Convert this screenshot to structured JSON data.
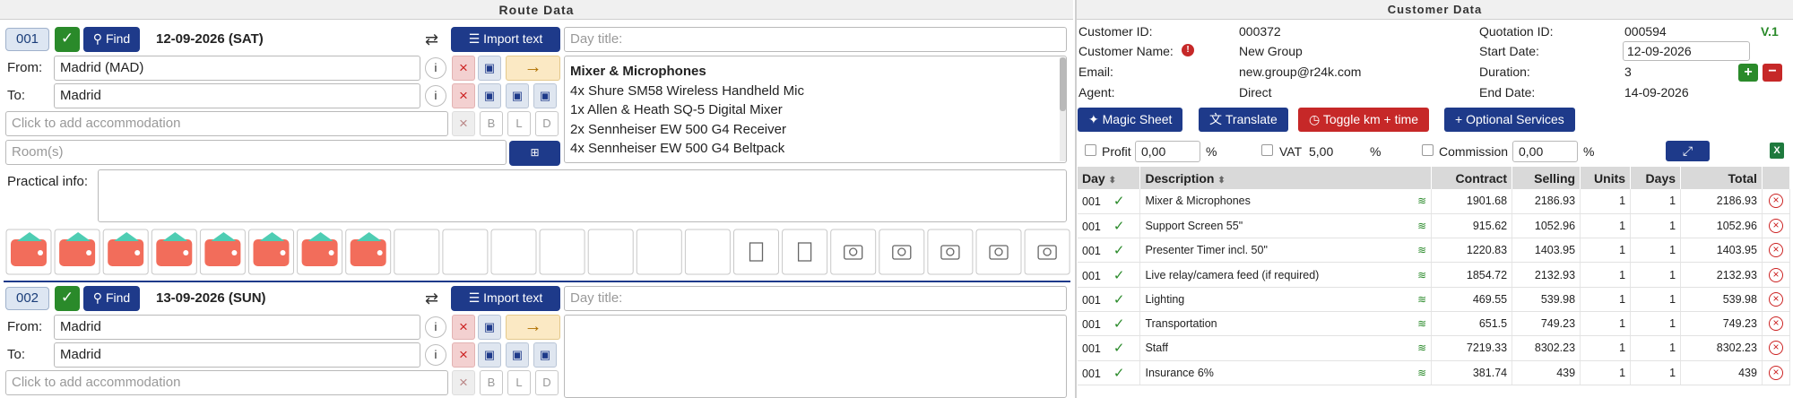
{
  "route": {
    "title": "Route Data"
  },
  "customer": {
    "title": "Customer Data",
    "version": "V.1",
    "fields": [
      {
        "label": "Customer ID:",
        "value": "000372"
      },
      {
        "label": "Customer Name:",
        "value": "New Group"
      },
      {
        "label": "Email:",
        "value": "new.group@r24k.com"
      },
      {
        "label": "Agent:",
        "value": "Direct"
      }
    ],
    "quotation_label": "Quotation ID:",
    "quotation_value": "000594",
    "start_label": "Start Date:",
    "start_value": "12-09-2026",
    "duration_label": "Duration:",
    "duration_value": "3",
    "end_label": "End Date:",
    "end_value": "14-09-2026",
    "buttons": {
      "magic": "Magic Sheet",
      "translate": "Translate",
      "toggle": "Toggle km + time",
      "optional": "Optional Services"
    },
    "profit_label": "Profit",
    "profit_value": "0,00",
    "pct": "%",
    "vat_label": "VAT",
    "vat_value": "5,00",
    "commission_label": "Commission",
    "commission_value": "0,00",
    "table": {
      "headers": [
        "Day",
        "Description",
        "Contract",
        "Selling",
        "Units",
        "Days",
        "Total"
      ],
      "rows": [
        {
          "day": "001",
          "desc": "Mixer & Microphones",
          "contract": "1901.68",
          "selling": "2186.93",
          "units": "1",
          "days": "1",
          "total": "2186.93"
        },
        {
          "day": "001",
          "desc": "Support Screen 55\"",
          "contract": "915.62",
          "selling": "1052.96",
          "units": "1",
          "days": "1",
          "total": "1052.96"
        },
        {
          "day": "001",
          "desc": "Presenter Timer incl. 50\"",
          "contract": "1220.83",
          "selling": "1403.95",
          "units": "1",
          "days": "1",
          "total": "1403.95"
        },
        {
          "day": "001",
          "desc": "Live relay/camera feed (if required)",
          "contract": "1854.72",
          "selling": "2132.93",
          "units": "1",
          "days": "1",
          "total": "2132.93"
        },
        {
          "day": "001",
          "desc": "Lighting",
          "contract": "469.55",
          "selling": "539.98",
          "units": "1",
          "days": "1",
          "total": "539.98"
        },
        {
          "day": "001",
          "desc": "Transportation",
          "contract": "651.5",
          "selling": "749.23",
          "units": "1",
          "days": "1",
          "total": "749.23"
        },
        {
          "day": "001",
          "desc": "Staff",
          "contract": "7219.33",
          "selling": "8302.23",
          "units": "1",
          "days": "1",
          "total": "8302.23"
        },
        {
          "day": "001",
          "desc": "Insurance 6%",
          "contract": "381.74",
          "selling": "439",
          "units": "1",
          "days": "1",
          "total": "439"
        }
      ]
    }
  },
  "days": [
    {
      "num": "001",
      "find": "Find",
      "date": "12-09-2026 (SAT)",
      "import": "Import text",
      "day_title_ph": "Day title:",
      "from_label": "From:",
      "from": "Madrid (MAD)",
      "to_label": "To:",
      "to": "Madrid",
      "accommodation_ph": "Click to add accommodation",
      "rooms_ph": "Room(s)",
      "practical_label": "Practical info:",
      "letters": [
        "B",
        "L",
        "D"
      ],
      "notes": [
        "Mixer & Microphones",
        "4x Shure SM58 Wireless Handheld Mic",
        "1x Allen & Heath SQ-5 Digital Mixer",
        "2x Sennheiser EW 500 G4 Receiver",
        "4x Sennheiser EW 500 G4 Beltpack"
      ]
    },
    {
      "num": "002",
      "find": "Find",
      "date": "13-09-2026 (SUN)",
      "import": "Import text",
      "day_title_ph": "Day title:",
      "from_label": "From:",
      "from": "Madrid",
      "to_label": "To:",
      "to": "Madrid",
      "accommodation_ph": "Click to add accommodation",
      "letters": [
        "B",
        "L",
        "D"
      ]
    }
  ],
  "colors": {
    "accent": "#1e3a8a",
    "green": "#2a8a2a",
    "red": "#c22222",
    "toggle": "#c62828"
  }
}
